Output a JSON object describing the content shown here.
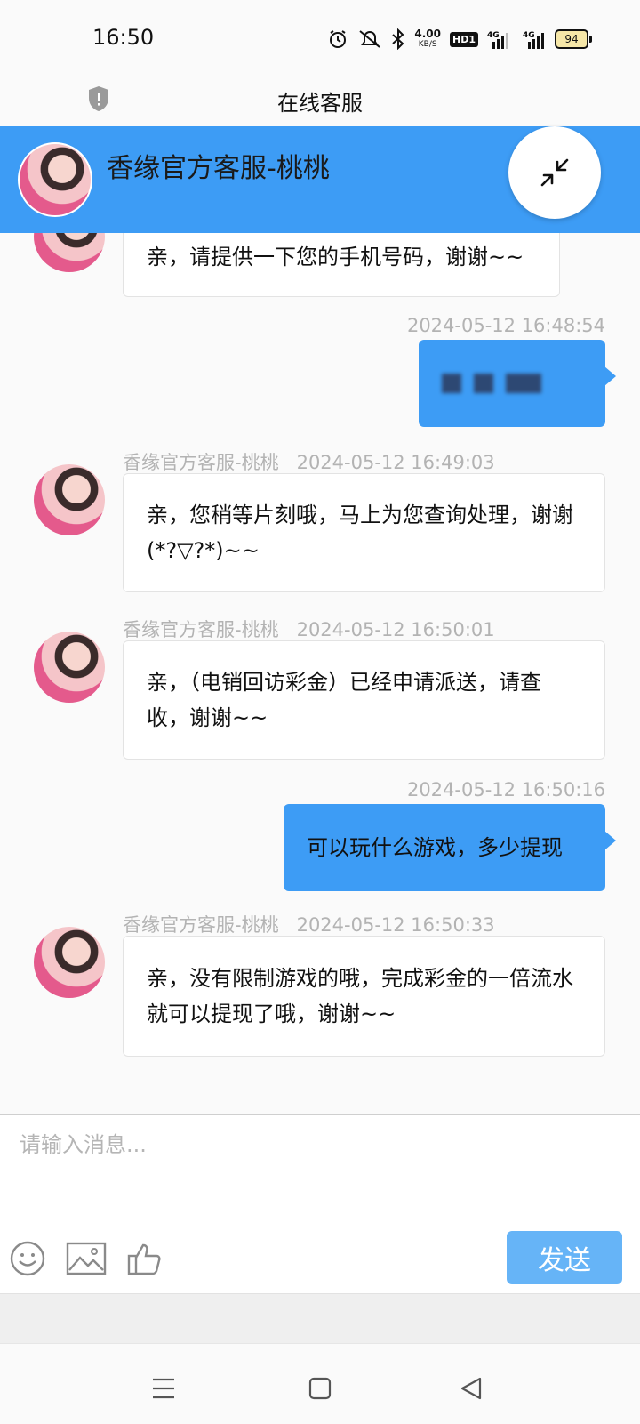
{
  "status_bar": {
    "time": "16:50",
    "net_speed": "4.00",
    "net_unit": "KB/S",
    "hd": "HD1",
    "battery": "94",
    "icons": [
      "alarm-icon",
      "mute-icon",
      "bluetooth-icon",
      "signal-4g-icon",
      "signal-4g-icon"
    ]
  },
  "titlebar": {
    "title": "在线客服",
    "icon": "shield-icon"
  },
  "header": {
    "agent_name": "香缘官方客服-桃桃",
    "minimize_icon": "minimize-icon"
  },
  "messages": [
    {
      "from": "agent",
      "text": "亲，请提供一下您的手机号码，谢谢~~"
    },
    {
      "from": "user",
      "time": "2024-05-12 16:48:54",
      "text": "",
      "redacted": true
    },
    {
      "from": "agent",
      "name": "香缘官方客服-桃桃",
      "time": "2024-05-12 16:49:03",
      "text": "亲，您稍等片刻哦，马上为您查询处理，谢谢(*?▽?*)~~"
    },
    {
      "from": "agent",
      "name": "香缘官方客服-桃桃",
      "time": "2024-05-12 16:50:01",
      "text": "亲，（电销回访彩金）已经申请派送，请查收，谢谢~~"
    },
    {
      "from": "user",
      "time": "2024-05-12 16:50:16",
      "text": "可以玩什么游戏，多少提现"
    },
    {
      "from": "agent",
      "name": "香缘官方客服-桃桃",
      "time": "2024-05-12 16:50:33",
      "text": "亲，没有限制游戏的哦，完成彩金的一倍流水就可以提现了哦，谢谢~~"
    }
  ],
  "composer": {
    "placeholder": "请输入消息...",
    "send_label": "发送",
    "tools": [
      "emoji-icon",
      "image-icon",
      "thumbs-up-icon"
    ]
  },
  "colors": {
    "accent": "#3d9cf5",
    "send_button": "#66b4f7",
    "meta_text": "#b3b3b3"
  }
}
